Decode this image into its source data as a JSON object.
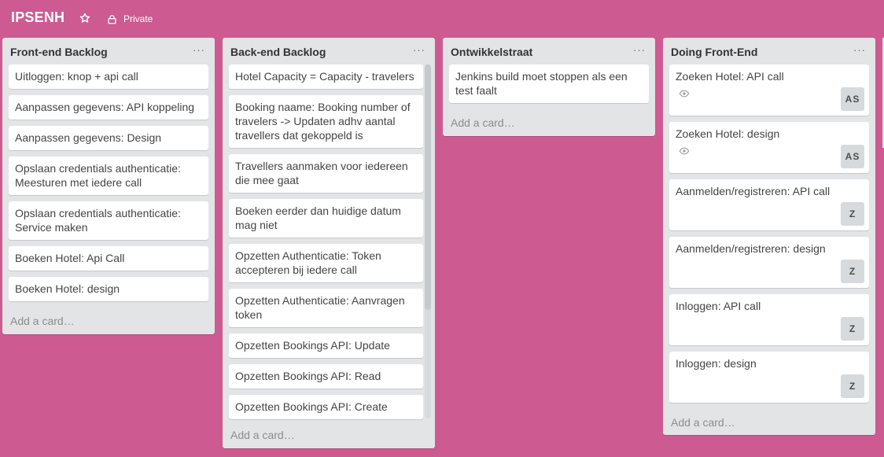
{
  "board": {
    "title": "IPSENH",
    "visibility": "Private"
  },
  "lists": [
    {
      "title": "Front-end Backlog",
      "menu": "···",
      "cards": [
        "Uitloggen: knop + api call",
        "Aanpassen gegevens: API koppeling",
        "Aanpassen gegevens: Design",
        "Opslaan credentials authenticatie: Meesturen met iedere call",
        "Opslaan credentials authenticatie: Service maken",
        "Boeken Hotel: Api Call",
        "Boeken Hotel: design"
      ],
      "add_card": "Add a card…"
    },
    {
      "title": "Back-end Backlog",
      "menu": "···",
      "cards": [
        "Hotel Capacity = Capacity - travelers",
        "Booking naame: Booking number of travelers -> Updaten adhv aantal travellers dat gekoppeld is",
        "Travellers aanmaken voor iedereen die mee gaat",
        "Boeken eerder dan huidige datum mag niet",
        "Opzetten Authenticatie: Token accepteren bij iedere call",
        "Opzetten Authenticatie: Aanvragen token",
        "Opzetten Bookings API: Update",
        "Opzetten Bookings API: Read",
        "Opzetten Bookings API: Create"
      ],
      "add_card": "Add a card…"
    },
    {
      "title": "Ontwikkelstraat",
      "menu": "···",
      "cards": [
        "Jenkins build moet stoppen als een test faalt"
      ],
      "add_card": "Add a card…"
    },
    {
      "title": "Doing Front-End",
      "menu": "···",
      "cards": [
        {
          "text": "Zoeken Hotel: API call",
          "member": "AS",
          "watching": true
        },
        {
          "text": "Zoeken Hotel: design",
          "member": "AS",
          "watching": true
        },
        {
          "text": "Aanmelden/registreren: API call",
          "member": "Z"
        },
        {
          "text": "Aanmelden/registreren: design",
          "member": "Z"
        },
        {
          "text": "Inloggen: API call",
          "member": "Z"
        },
        {
          "text": "Inloggen: design",
          "member": "Z"
        }
      ],
      "add_card": "Add a card…"
    }
  ],
  "colors": {
    "board_background": "#cd5a91",
    "list_background": "#e2e4e6",
    "card_background": "#ffffff"
  }
}
